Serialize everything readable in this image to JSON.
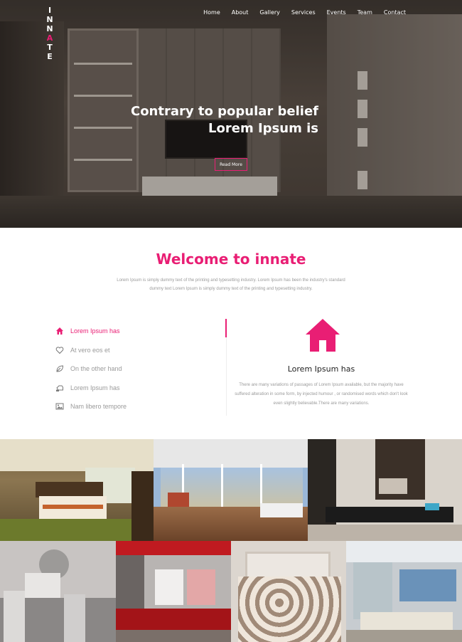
{
  "logo": {
    "letters": [
      "I",
      "N",
      "N",
      "A",
      "T",
      "E"
    ],
    "accent_index": 3
  },
  "nav": [
    "Home",
    "About",
    "Gallery",
    "Services",
    "Events",
    "Team",
    "Contact"
  ],
  "hero": {
    "title_line1": "Contrary to popular belief",
    "title_line2": "Lorem Ipsum is",
    "button_label": "Read More"
  },
  "welcome": {
    "title": "Welcome to innate",
    "text": "Lorem Ipsum is simply dummy text of the printing and typesetting industry. Lorem Ipsum has been the industry's standard dummy text Lorem Ipsum is simply dummy text of the printing and typesetting industry."
  },
  "features": [
    {
      "label": "Lorem Ipsum has",
      "icon": "home-icon",
      "active": true
    },
    {
      "label": "At vero eos et",
      "icon": "heart-icon",
      "active": false
    },
    {
      "label": "On the other hand",
      "icon": "leaf-icon",
      "active": false
    },
    {
      "label": "Lorem Ipsum has",
      "icon": "hand-icon",
      "active": false
    },
    {
      "label": "Nam libero tempore",
      "icon": "picture-icon",
      "active": false
    }
  ],
  "card": {
    "icon": "home-icon",
    "title": "Lorem Ipsum has",
    "text": "There are many variations of passages of Lorem Ipsum available, but the majority have suffered alteration in some form, by injected humour , or randomised words which don't look even slightly believable.There are many variations."
  },
  "colors": {
    "accent": "#e91e74",
    "text_gray": "#9a9a9a",
    "heading": "#222222"
  },
  "gallery": [
    "bedroom-photo",
    "balcony-room-photo",
    "study-room-photo",
    "dining-room-photo",
    "red-living-room-photo",
    "bedroom-floral-photo",
    "bathroom-photo"
  ]
}
